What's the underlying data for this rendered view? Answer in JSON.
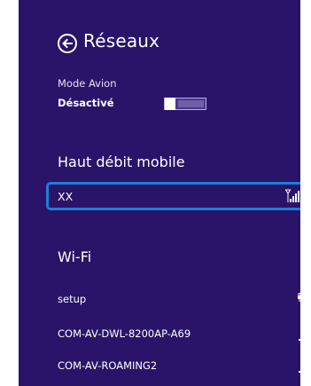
{
  "header": {
    "title": "Réseaux",
    "back_icon": "back-arrow-circle-icon"
  },
  "airplane_mode": {
    "label": "Mode Avion",
    "state": "Désactivé",
    "enabled": false
  },
  "mobile_broadband": {
    "heading": "Haut débit mobile",
    "items": [
      {
        "name": "XX",
        "icon": "mobile-signal-icon",
        "selected": true
      }
    ]
  },
  "wifi": {
    "heading": "Wi-Fi",
    "networks": [
      {
        "name": "setup",
        "icon": "wifi-secured-signal-icon"
      },
      {
        "name": "COM-AV-DWL-8200AP-A69",
        "icon": "wifi-signal-icon"
      },
      {
        "name": "COM-AV-ROAMING2",
        "icon": "wifi-signal-icon"
      }
    ]
  },
  "colors": {
    "panel_background": "#2a1469",
    "selection_border": "#1b7fd6",
    "text": "#ffffff"
  }
}
